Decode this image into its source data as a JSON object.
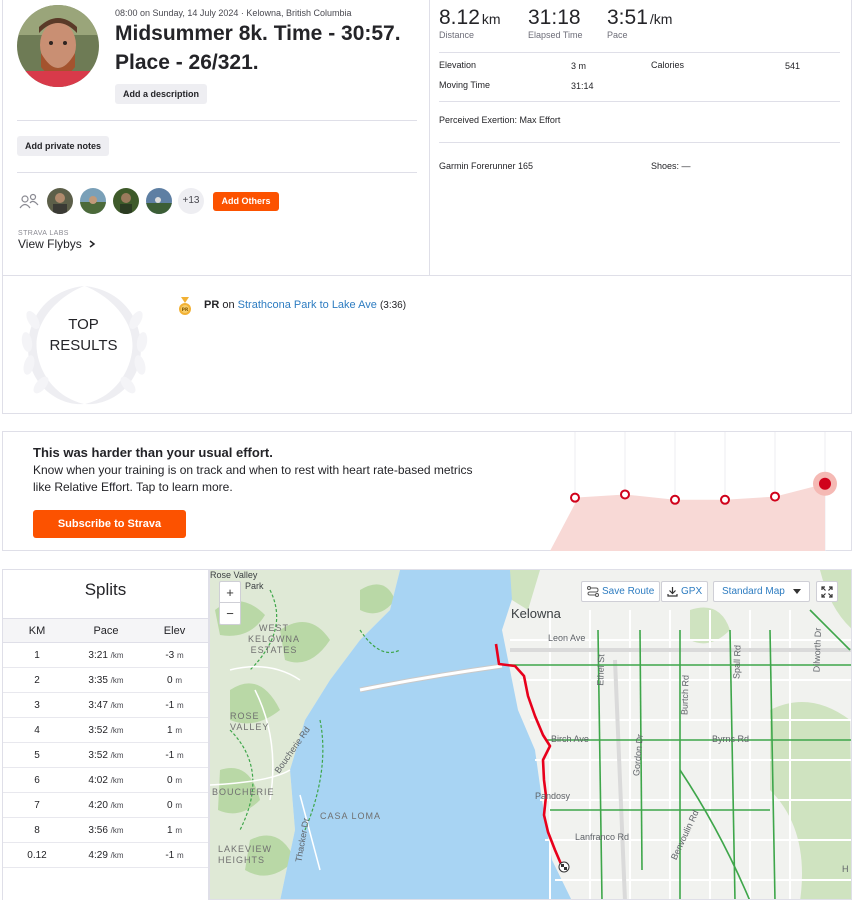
{
  "activity": {
    "meta_date": "08:00 on Sunday, 14 July 2024 · Kelowna, British Columbia",
    "title": "Midsummer 8k. Time - 30:57. Place - 26/321.",
    "add_description": "Add a description",
    "add_private_notes": "Add private notes",
    "kudos_more": "+13",
    "add_others": "Add Others",
    "labs_label": "STRAVA LABS",
    "flybys_label": "View Flybys",
    "icons": {
      "group": "people-icon",
      "chevron": "chevron-right-icon"
    }
  },
  "stats": {
    "primary": [
      {
        "value": "8.12",
        "unit": "km",
        "label": "Distance"
      },
      {
        "value": "31:18",
        "unit": "",
        "label": "Elapsed Time"
      },
      {
        "value": "3:51",
        "unit": "/km",
        "label": "Pace"
      }
    ],
    "elevation_label": "Elevation",
    "elevation_value": "3 m",
    "moving_time_label": "Moving Time",
    "moving_time_value": "31:14",
    "calories_label": "Calories",
    "calories_value": "541",
    "perceived_exertion": "Perceived Exertion: Max Effort",
    "device": "Garmin Forerunner 165",
    "shoes": "Shoes: —"
  },
  "results": {
    "top_line1": "TOP",
    "top_line2": "RESULTS",
    "pr_label": "PR",
    "pr_on": "on",
    "segment": "Strathcona Park to Lake Ave",
    "segment_time": "(3:36)",
    "medal_icon": "pr-medal-icon"
  },
  "promo": {
    "title": "This was harder than your usual effort.",
    "body": "Know when your training is on track and when to rest with heart rate-based metrics like Relative Effort. Tap to learn more.",
    "button": "Subscribe to Strava",
    "effort_points": [
      0.33,
      0.36,
      0.31,
      0.31,
      0.34,
      0.46
    ],
    "accent": "#fc5200",
    "point_color": "#d0021b"
  },
  "splits": {
    "title": "Splits",
    "headers": [
      "KM",
      "Pace",
      "Elev"
    ],
    "pace_unit": "/km",
    "elev_unit": "m",
    "rows": [
      {
        "km": "1",
        "pace": "3:21",
        "elev": "-3"
      },
      {
        "km": "2",
        "pace": "3:35",
        "elev": "0"
      },
      {
        "km": "3",
        "pace": "3:47",
        "elev": "-1"
      },
      {
        "km": "4",
        "pace": "3:52",
        "elev": "1"
      },
      {
        "km": "5",
        "pace": "3:52",
        "elev": "-1"
      },
      {
        "km": "6",
        "pace": "4:02",
        "elev": "0"
      },
      {
        "km": "7",
        "pace": "4:20",
        "elev": "0"
      },
      {
        "km": "8",
        "pace": "3:56",
        "elev": "1"
      },
      {
        "km": "0.12",
        "pace": "4:29",
        "elev": "-1"
      }
    ]
  },
  "map": {
    "zoom_in": "+",
    "zoom_out": "−",
    "save_route": "Save Route",
    "gpx": "GPX",
    "map_style": "Standard Map",
    "labels": {
      "rose_valley_park": "Rose Valley",
      "park": "Park",
      "kelowna": "Kelowna",
      "west_kelowna_estates": "WEST\nKELOWNA\nESTATES",
      "rose_valley": "ROSE\nVALLEY",
      "boucherie_rd": "Boucherie Rd",
      "boucherie": "BOUCHERIE",
      "casa_loma": "CASA LOMA",
      "lakeview_heights": "LAKEVIEW\nHEIGHTS",
      "thacker_dr": "Thacker Dr",
      "leon_ave": "Leon Ave",
      "ethel_st": "Ethel St",
      "burtch_rd": "Burtch Rd",
      "spall_rd": "Spall Rd",
      "dilworth_dr": "Dilworth Dr",
      "birch_ave": "Birch Ave",
      "byrns_rd": "Byrns Rd",
      "gordon_dr": "Gordon Dr",
      "pandosy": "Pandosy",
      "lanfranco_rd": "Lanfranco Rd",
      "benvoulin_rd": "Benvoulin Rd",
      "h": "H"
    },
    "route_color": "#e8001c",
    "water_color": "#a8d4f3"
  }
}
